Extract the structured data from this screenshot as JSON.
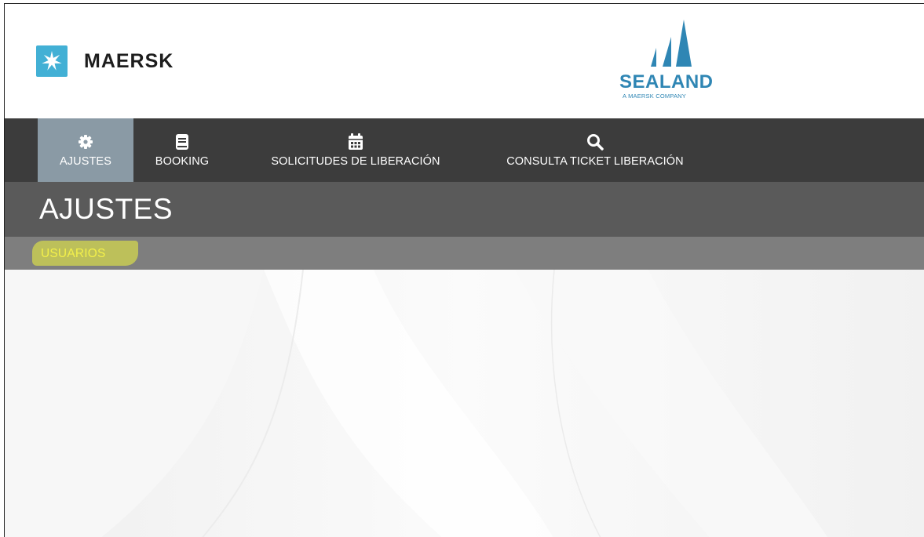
{
  "brand": {
    "maersk_name": "MAERSK",
    "sealand_name": "SEALAND",
    "sealand_tagline": "A MAERSK COMPANY",
    "maersk_color": "#42b0d5",
    "sealand_color": "#2f86b4"
  },
  "nav": {
    "items": [
      {
        "label": "AJUSTES",
        "icon": "gear-icon",
        "active": true
      },
      {
        "label": "BOOKING",
        "icon": "book-icon",
        "active": false
      },
      {
        "label": "SOLICITUDES DE LIBERACIÓN",
        "icon": "calendar-icon",
        "active": false
      },
      {
        "label": "CONSULTA TICKET LIBERACIÓN",
        "icon": "search-icon",
        "active": false
      }
    ]
  },
  "page": {
    "title": "AJUSTES"
  },
  "subnav": {
    "items": [
      {
        "label": "USUARIOS",
        "highlighted": true
      }
    ]
  },
  "colors": {
    "nav_bg": "#3c3c3c",
    "nav_active_bg": "#8a9aa5",
    "title_bar_bg": "#5a5a5a",
    "subnav_bg": "#7e7e7e",
    "subnav_text": "#f3f04a",
    "highlight": "#f0f53c"
  }
}
